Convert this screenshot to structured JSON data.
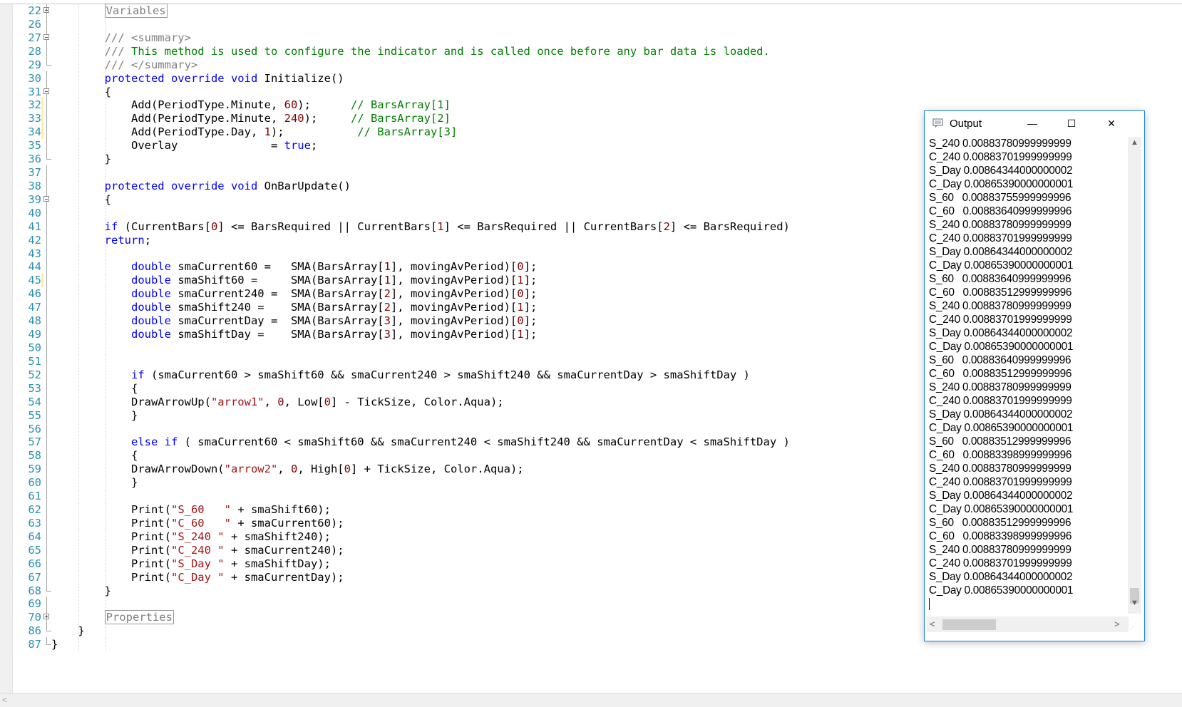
{
  "editor": {
    "lines": [
      {
        "n": "22",
        "fold": "plus",
        "segs": [
          {
            "t": "        ",
            "c": "pl"
          },
          {
            "t": "Variables",
            "c": "region"
          }
        ]
      },
      {
        "n": "26",
        "fold": "line",
        "segs": []
      },
      {
        "n": "27",
        "fold": "minus",
        "segs": [
          {
            "t": "        /// <summary>",
            "c": "cm-gray"
          }
        ]
      },
      {
        "n": "28",
        "fold": "line",
        "segs": [
          {
            "t": "        /// ",
            "c": "cm-gray"
          },
          {
            "t": "This method is used to configure the indicator and is called once before any bar data is loaded.",
            "c": "cm"
          }
        ]
      },
      {
        "n": "29",
        "fold": "end",
        "segs": [
          {
            "t": "        /// </summary>",
            "c": "cm-gray"
          }
        ]
      },
      {
        "n": "30",
        "fold": "line",
        "segs": [
          {
            "t": "        ",
            "c": "pl"
          },
          {
            "t": "protected override void",
            "c": "kw"
          },
          {
            "t": " Initialize()",
            "c": "pl"
          }
        ]
      },
      {
        "n": "31",
        "fold": "minus",
        "segs": [
          {
            "t": "        {",
            "c": "pl"
          }
        ]
      },
      {
        "n": "32",
        "fold": "line",
        "change": true,
        "segs": [
          {
            "t": "            Add(PeriodType.Minute, ",
            "c": "pl"
          },
          {
            "t": "60",
            "c": "nm"
          },
          {
            "t": ");      ",
            "c": "pl"
          },
          {
            "t": "// BarsArray[1]",
            "c": "cm"
          }
        ]
      },
      {
        "n": "33",
        "fold": "line",
        "change": true,
        "segs": [
          {
            "t": "            Add(PeriodType.Minute, ",
            "c": "pl"
          },
          {
            "t": "240",
            "c": "nm"
          },
          {
            "t": ");     ",
            "c": "pl"
          },
          {
            "t": "// BarsArray[2]",
            "c": "cm"
          }
        ]
      },
      {
        "n": "34",
        "fold": "line",
        "change": true,
        "segs": [
          {
            "t": "            Add(PeriodType.Day, ",
            "c": "pl"
          },
          {
            "t": "1",
            "c": "nm"
          },
          {
            "t": ");           ",
            "c": "pl"
          },
          {
            "t": "// BarsArray[3]",
            "c": "cm"
          }
        ]
      },
      {
        "n": "35",
        "fold": "line",
        "segs": [
          {
            "t": "            Overlay              = ",
            "c": "pl"
          },
          {
            "t": "true",
            "c": "kw"
          },
          {
            "t": ";",
            "c": "pl"
          }
        ]
      },
      {
        "n": "36",
        "fold": "end",
        "segs": [
          {
            "t": "        }",
            "c": "pl"
          }
        ]
      },
      {
        "n": "37",
        "fold": "line",
        "segs": []
      },
      {
        "n": "38",
        "fold": "line",
        "segs": [
          {
            "t": "        ",
            "c": "pl"
          },
          {
            "t": "protected override void",
            "c": "kw"
          },
          {
            "t": " OnBarUpdate()",
            "c": "pl"
          }
        ]
      },
      {
        "n": "39",
        "fold": "minus",
        "segs": [
          {
            "t": "        {",
            "c": "pl"
          }
        ]
      },
      {
        "n": "40",
        "fold": "line",
        "segs": []
      },
      {
        "n": "41",
        "fold": "line",
        "segs": [
          {
            "t": "        ",
            "c": "pl"
          },
          {
            "t": "if",
            "c": "kw"
          },
          {
            "t": " (CurrentBars[",
            "c": "pl"
          },
          {
            "t": "0",
            "c": "nm"
          },
          {
            "t": "] <= BarsRequired || CurrentBars[",
            "c": "pl"
          },
          {
            "t": "1",
            "c": "nm"
          },
          {
            "t": "] <= BarsRequired || CurrentBars[",
            "c": "pl"
          },
          {
            "t": "2",
            "c": "nm"
          },
          {
            "t": "] <= BarsRequired)",
            "c": "pl"
          }
        ]
      },
      {
        "n": "42",
        "fold": "line",
        "segs": [
          {
            "t": "        ",
            "c": "pl"
          },
          {
            "t": "return",
            "c": "kw"
          },
          {
            "t": ";",
            "c": "pl"
          }
        ]
      },
      {
        "n": "43",
        "fold": "line",
        "segs": []
      },
      {
        "n": "44",
        "fold": "line",
        "segs": [
          {
            "t": "            ",
            "c": "pl"
          },
          {
            "t": "double",
            "c": "kw"
          },
          {
            "t": " smaCurrent60 =   SMA(BarsArray[",
            "c": "pl"
          },
          {
            "t": "1",
            "c": "nm"
          },
          {
            "t": "], movingAvPeriod)[",
            "c": "pl"
          },
          {
            "t": "0",
            "c": "nm"
          },
          {
            "t": "];",
            "c": "pl"
          }
        ]
      },
      {
        "n": "45",
        "fold": "line",
        "change": true,
        "segs": [
          {
            "t": "            ",
            "c": "pl"
          },
          {
            "t": "double",
            "c": "kw"
          },
          {
            "t": " smaShift60 =     SMA(BarsArray[",
            "c": "pl"
          },
          {
            "t": "1",
            "c": "nm"
          },
          {
            "t": "], movingAvPeriod)[",
            "c": "pl"
          },
          {
            "t": "1",
            "c": "nm"
          },
          {
            "t": "];",
            "c": "pl"
          }
        ]
      },
      {
        "n": "46",
        "fold": "line",
        "segs": [
          {
            "t": "            ",
            "c": "pl"
          },
          {
            "t": "double",
            "c": "kw"
          },
          {
            "t": " smaCurrent240 =  SMA(BarsArray[",
            "c": "pl"
          },
          {
            "t": "2",
            "c": "nm"
          },
          {
            "t": "], movingAvPeriod)[",
            "c": "pl"
          },
          {
            "t": "0",
            "c": "nm"
          },
          {
            "t": "];",
            "c": "pl"
          }
        ]
      },
      {
        "n": "47",
        "fold": "line",
        "segs": [
          {
            "t": "            ",
            "c": "pl"
          },
          {
            "t": "double",
            "c": "kw"
          },
          {
            "t": " smaShift240 =    SMA(BarsArray[",
            "c": "pl"
          },
          {
            "t": "2",
            "c": "nm"
          },
          {
            "t": "], movingAvPeriod)[",
            "c": "pl"
          },
          {
            "t": "1",
            "c": "nm"
          },
          {
            "t": "];",
            "c": "pl"
          }
        ]
      },
      {
        "n": "48",
        "fold": "line",
        "segs": [
          {
            "t": "            ",
            "c": "pl"
          },
          {
            "t": "double",
            "c": "kw"
          },
          {
            "t": " smaCurrentDay =  SMA(BarsArray[",
            "c": "pl"
          },
          {
            "t": "3",
            "c": "nm"
          },
          {
            "t": "], movingAvPeriod)[",
            "c": "pl"
          },
          {
            "t": "0",
            "c": "nm"
          },
          {
            "t": "];",
            "c": "pl"
          }
        ]
      },
      {
        "n": "49",
        "fold": "line",
        "segs": [
          {
            "t": "            ",
            "c": "pl"
          },
          {
            "t": "double",
            "c": "kw"
          },
          {
            "t": " smaShiftDay =    SMA(BarsArray[",
            "c": "pl"
          },
          {
            "t": "3",
            "c": "nm"
          },
          {
            "t": "], movingAvPeriod)[",
            "c": "pl"
          },
          {
            "t": "1",
            "c": "nm"
          },
          {
            "t": "];",
            "c": "pl"
          }
        ]
      },
      {
        "n": "50",
        "fold": "line",
        "segs": []
      },
      {
        "n": "51",
        "fold": "line",
        "segs": []
      },
      {
        "n": "52",
        "fold": "line",
        "segs": [
          {
            "t": "            ",
            "c": "pl"
          },
          {
            "t": "if",
            "c": "kw"
          },
          {
            "t": " (smaCurrent60 > smaShift60 && smaCurrent240 > smaShift240 && smaCurrentDay > smaShiftDay )",
            "c": "pl"
          }
        ]
      },
      {
        "n": "53",
        "fold": "line",
        "segs": [
          {
            "t": "            {",
            "c": "pl"
          }
        ]
      },
      {
        "n": "54",
        "fold": "line",
        "segs": [
          {
            "t": "            DrawArrowUp(",
            "c": "pl"
          },
          {
            "t": "\"arrow1\"",
            "c": "st"
          },
          {
            "t": ", ",
            "c": "pl"
          },
          {
            "t": "0",
            "c": "nm"
          },
          {
            "t": ", Low[",
            "c": "pl"
          },
          {
            "t": "0",
            "c": "nm"
          },
          {
            "t": "] - TickSize, Color.Aqua);",
            "c": "pl"
          }
        ]
      },
      {
        "n": "55",
        "fold": "line",
        "segs": [
          {
            "t": "            }",
            "c": "pl"
          }
        ]
      },
      {
        "n": "56",
        "fold": "line",
        "segs": []
      },
      {
        "n": "57",
        "fold": "line",
        "segs": [
          {
            "t": "            ",
            "c": "pl"
          },
          {
            "t": "else if",
            "c": "kw"
          },
          {
            "t": " ( smaCurrent60 < smaShift60 && smaCurrent240 < smaShift240 && smaCurrentDay < smaShiftDay )",
            "c": "pl"
          }
        ]
      },
      {
        "n": "58",
        "fold": "line",
        "segs": [
          {
            "t": "            {",
            "c": "pl"
          }
        ]
      },
      {
        "n": "59",
        "fold": "line",
        "segs": [
          {
            "t": "            DrawArrowDown(",
            "c": "pl"
          },
          {
            "t": "\"arrow2\"",
            "c": "st"
          },
          {
            "t": ", ",
            "c": "pl"
          },
          {
            "t": "0",
            "c": "nm"
          },
          {
            "t": ", High[",
            "c": "pl"
          },
          {
            "t": "0",
            "c": "nm"
          },
          {
            "t": "] + TickSize, Color.Aqua);",
            "c": "pl"
          }
        ]
      },
      {
        "n": "60",
        "fold": "line",
        "segs": [
          {
            "t": "            }",
            "c": "pl"
          }
        ]
      },
      {
        "n": "61",
        "fold": "line",
        "segs": []
      },
      {
        "n": "62",
        "fold": "line",
        "segs": [
          {
            "t": "            Print(",
            "c": "pl"
          },
          {
            "t": "\"S_60   \"",
            "c": "st"
          },
          {
            "t": " + smaShift60);",
            "c": "pl"
          }
        ]
      },
      {
        "n": "63",
        "fold": "line",
        "segs": [
          {
            "t": "            Print(",
            "c": "pl"
          },
          {
            "t": "\"C_60   \"",
            "c": "st"
          },
          {
            "t": " + smaCurrent60);",
            "c": "pl"
          }
        ]
      },
      {
        "n": "64",
        "fold": "line",
        "segs": [
          {
            "t": "            Print(",
            "c": "pl"
          },
          {
            "t": "\"S_240 \"",
            "c": "st"
          },
          {
            "t": " + smaShift240);",
            "c": "pl"
          }
        ]
      },
      {
        "n": "65",
        "fold": "line",
        "segs": [
          {
            "t": "            Print(",
            "c": "pl"
          },
          {
            "t": "\"C_240 \"",
            "c": "st"
          },
          {
            "t": " + smaCurrent240);",
            "c": "pl"
          }
        ]
      },
      {
        "n": "66",
        "fold": "line",
        "segs": [
          {
            "t": "            Print(",
            "c": "pl"
          },
          {
            "t": "\"S_Day \"",
            "c": "st"
          },
          {
            "t": " + smaShiftDay);",
            "c": "pl"
          }
        ]
      },
      {
        "n": "67",
        "fold": "line",
        "segs": [
          {
            "t": "            Print(",
            "c": "pl"
          },
          {
            "t": "\"C_Day \"",
            "c": "st"
          },
          {
            "t": " + smaCurrentDay);",
            "c": "pl"
          }
        ]
      },
      {
        "n": "68",
        "fold": "end",
        "segs": [
          {
            "t": "        }",
            "c": "pl"
          }
        ]
      },
      {
        "n": "69",
        "fold": "line",
        "segs": []
      },
      {
        "n": "70",
        "fold": "plus",
        "segs": [
          {
            "t": "        ",
            "c": "pl"
          },
          {
            "t": "Properties",
            "c": "region"
          }
        ]
      },
      {
        "n": "86",
        "fold": "end",
        "segs": [
          {
            "t": "    }",
            "c": "pl"
          }
        ]
      },
      {
        "n": "87",
        "fold": "end",
        "segs": [
          {
            "t": "}",
            "c": "pl"
          }
        ]
      }
    ]
  },
  "output_window": {
    "title": "Output",
    "minimize": "—",
    "maximize": "☐",
    "close": "✕",
    "lines": [
      "S_240 0.00883780999999999",
      "C_240 0.00883701999999999",
      "S_Day 0.00864344000000002",
      "C_Day 0.00865390000000001",
      "S_60   0.00883755999999996",
      "C_60   0.00883640999999996",
      "S_240 0.00883780999999999",
      "C_240 0.00883701999999999",
      "S_Day 0.00864344000000002",
      "C_Day 0.00865390000000001",
      "S_60   0.00883640999999996",
      "C_60   0.00883512999999996",
      "S_240 0.00883780999999999",
      "C_240 0.00883701999999999",
      "S_Day 0.00864344000000002",
      "C_Day 0.00865390000000001",
      "S_60   0.00883640999999996",
      "C_60   0.00883512999999996",
      "S_240 0.00883780999999999",
      "C_240 0.00883701999999999",
      "S_Day 0.00864344000000002",
      "C_Day 0.00865390000000001",
      "S_60   0.00883512999999996",
      "C_60   0.00883398999999996",
      "S_240 0.00883780999999999",
      "C_240 0.00883701999999999",
      "S_Day 0.00864344000000002",
      "C_Day 0.00865390000000001",
      "S_60   0.00883512999999996",
      "C_60   0.00883398999999996",
      "S_240 0.00883780999999999",
      "C_240 0.00883701999999999",
      "S_Day 0.00864344000000002",
      "C_Day 0.00865390000000001"
    ]
  },
  "colors": {
    "keyword": "#0000ff",
    "comment": "#008000",
    "number": "#800000",
    "string": "#a31515",
    "line_number": "#2b91af",
    "window_border": "#1883d7"
  }
}
